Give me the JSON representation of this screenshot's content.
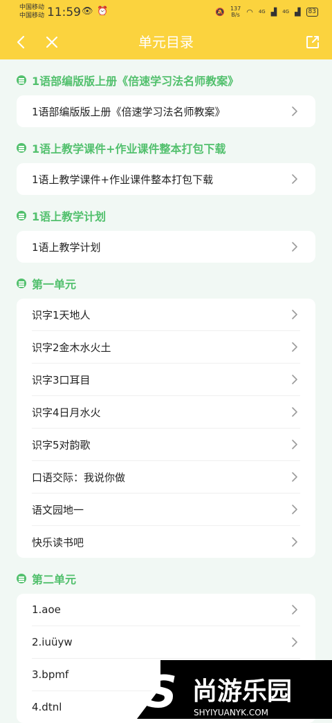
{
  "status": {
    "carrier_1": "中国移动",
    "carrier_2": "中国移动",
    "time": "11:59",
    "net_speed": "137",
    "net_unit": "B/s",
    "signal_1": "4G",
    "signal_2": "4G",
    "battery": "83"
  },
  "nav": {
    "title": "单元目录"
  },
  "sections": [
    {
      "title": "1语部编版版上册《倍速学习法名师教案》",
      "items": [
        "1语部编版版上册《倍速学习法名师教案》"
      ]
    },
    {
      "title": "1语上教学课件+作业课件整本打包下载",
      "items": [
        "1语上教学课件+作业课件整本打包下载"
      ]
    },
    {
      "title": "1语上教学计划",
      "items": [
        "1语上教学计划"
      ]
    },
    {
      "title": "第一单元",
      "items": [
        "识字1天地人",
        "识字2金木水火土",
        "识字3口耳目",
        "识字4日月水火",
        "识字5对韵歌",
        "口语交际：我说你做",
        "语文园地一",
        "快乐读书吧"
      ]
    },
    {
      "title": "第二单元",
      "items": [
        "1.aoe",
        "2.iuüyw",
        "3.bpmf",
        "4.dtnl"
      ]
    }
  ],
  "watermark": {
    "brand": "尚游乐园",
    "url": "SHYIYUANYK.COM"
  },
  "colors": {
    "header": "#fbd33e",
    "accent": "#52c06d",
    "background": "#f1f8f4"
  }
}
